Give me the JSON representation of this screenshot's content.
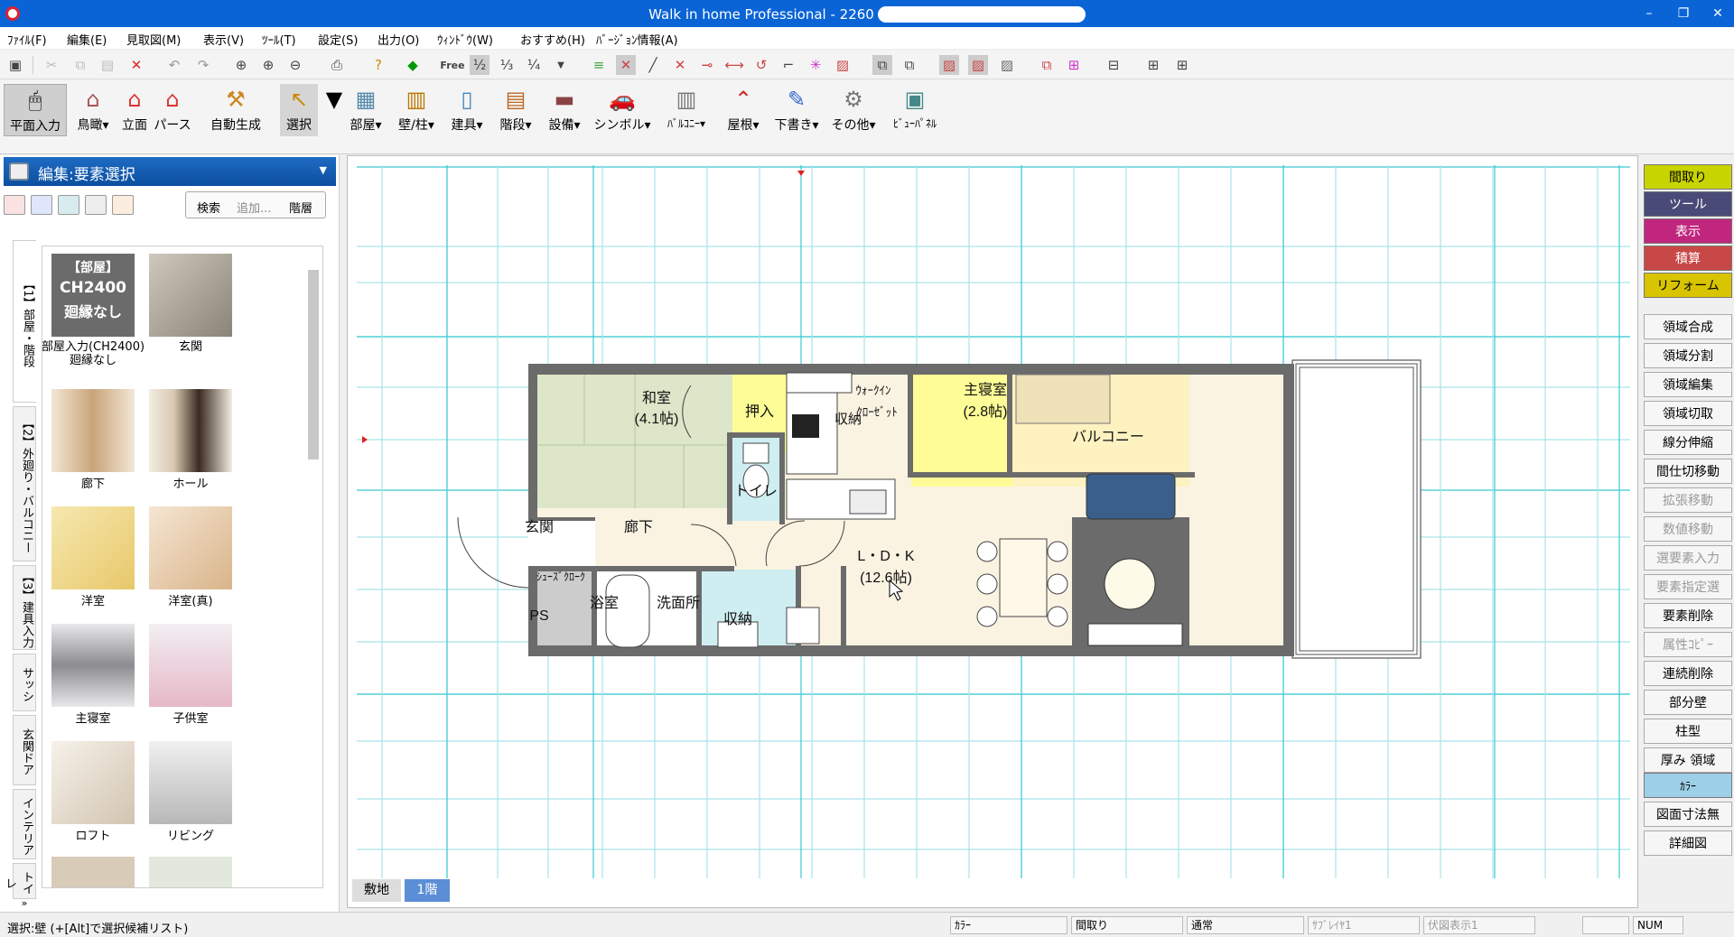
{
  "window": {
    "title": "Walk in home Professional - 2260",
    "minimize": "–",
    "restore": "❐",
    "close": "✕"
  },
  "menu": [
    "ﾌｧｲﾙ(F)",
    "編集(E)",
    "見取図(M)",
    "表示(V)",
    "ﾂｰﾙ(T)",
    "設定(S)",
    "出力(O)",
    "ｳｨﾝﾄﾞｳ(W)",
    "おすすめ(H)",
    "ﾊﾞｰｼﾞｮﾝ情報(A)"
  ],
  "toolbar1": {
    "free_label": "Free",
    "half": "½",
    "third": "⅓",
    "quarter": "¼"
  },
  "toolbar2": {
    "plan_input": "平面入力",
    "bird_eye": "鳥瞰",
    "elevation": "立面",
    "perspective": "パース",
    "auto_generate": "自動生成",
    "select": "選択",
    "room": "部屋",
    "wall_column": "壁/柱",
    "fittings": "建具",
    "stairs": "階段",
    "equipment": "設備",
    "symbol": "シンボル",
    "balcony": "ﾊﾞﾙｺﾆｰ",
    "roof": "屋根",
    "draft": "下書き",
    "other": "その他",
    "view_panel": "ﾋﾞｭｰﾊﾟﾈﾙ"
  },
  "left_panel": {
    "header": "編集:要素選択",
    "search": "検索",
    "add": "追加...",
    "floor": "階層",
    "vtabs": [
      "【1】部屋・階段",
      "【2】外廻り・バルコニー",
      "【3】建具入力",
      "サッシ",
      "玄関ドア",
      "インテリア",
      "トイレ"
    ],
    "room_card": {
      "line1": "【部屋】",
      "line2": "CH2400",
      "line3": "廻縁なし"
    },
    "items": [
      {
        "caption": "部屋入力(CH2400)廻縁なし",
        "color": "#6b6b6b"
      },
      {
        "caption": "玄関",
        "color": "#8a8478"
      },
      {
        "caption": "廊下",
        "color": "#c9a57a"
      },
      {
        "caption": "ホール",
        "color": "#d8c8b0"
      },
      {
        "caption": "洋室",
        "color": "#e8c86a"
      },
      {
        "caption": "洋室(真)",
        "color": "#d9b48a"
      },
      {
        "caption": "主寝室",
        "color": "#8c8c90"
      },
      {
        "caption": "子供室",
        "color": "#e6b8c8"
      },
      {
        "caption": "ロフト",
        "color": "#d2c4b0"
      },
      {
        "caption": "リビング",
        "color": "#b8b8b8"
      }
    ]
  },
  "floor_plan": {
    "rooms": {
      "washitsu": "和室",
      "washitsu_size": "(4.1帖)",
      "oshiire": "押入",
      "toilet": "トイレ",
      "walkin": "ｳｫｰｸｲﾝ",
      "closet": "ｸﾛｰｾﾞｯﾄ",
      "storage": "収納",
      "master": "主寝室",
      "master_size": "(2.8帖)",
      "genkan": "玄関",
      "rouka": "廊下",
      "ldk": "L・D・K",
      "ldk_size": "(12.6帖)",
      "shoes": "ｼｭｰｽﾞｸﾛｰｸ",
      "ps": "PS",
      "bath": "浴室",
      "washroom": "洗面所",
      "storage2": "収納",
      "balcony": "バルコニー"
    }
  },
  "floor_tabs": [
    "敷地",
    "1階"
  ],
  "right_panel": {
    "tabs": [
      {
        "label": "間取り",
        "color": "#c8d400",
        "text": "#000"
      },
      {
        "label": "ツール",
        "color": "#4a4a78",
        "text": "#fff"
      },
      {
        "label": "表示",
        "color": "#c0267e",
        "text": "#fff"
      },
      {
        "label": "積算",
        "color": "#c84848",
        "text": "#fff"
      },
      {
        "label": "リフォーム",
        "color": "#d8c400",
        "text": "#000"
      }
    ],
    "buttons": [
      {
        "label": "領域合成",
        "enabled": true
      },
      {
        "label": "領域分割",
        "enabled": true
      },
      {
        "label": "領域編集",
        "enabled": true
      },
      {
        "label": "領域切取",
        "enabled": true
      },
      {
        "label": "線分伸縮",
        "enabled": true
      },
      {
        "label": "間仕切移動",
        "enabled": true
      },
      {
        "label": "拡張移動",
        "enabled": false
      },
      {
        "label": "数値移動",
        "enabled": false
      },
      {
        "label": "選要素入力",
        "enabled": false
      },
      {
        "label": "要素指定選",
        "enabled": false
      },
      {
        "label": "要素削除",
        "enabled": true
      },
      {
        "label": "属性ｺﾋﾟｰ",
        "enabled": false
      },
      {
        "label": "連続削除",
        "enabled": true
      },
      {
        "label": "部分壁",
        "enabled": true
      },
      {
        "label": "柱型",
        "enabled": true
      },
      {
        "label": "厚み 領域",
        "enabled": true
      }
    ],
    "color_tab": "ｶﾗｰ",
    "bottom_buttons": [
      "図面寸法無",
      "詳細図"
    ]
  },
  "status": {
    "message": "選択:壁 (+[Alt]で選択候補リスト)",
    "fields": [
      "ｶﾗｰ",
      "間取り",
      "通常",
      "ｻﾌﾞﾚｲﾔ1",
      "伏図表示1",
      ""
    ],
    "num": "NUM"
  }
}
